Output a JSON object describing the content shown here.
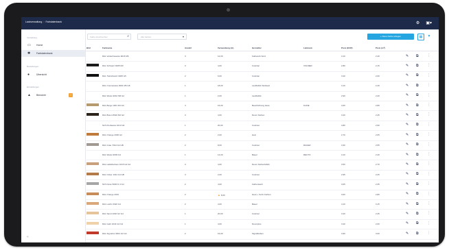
{
  "app": {
    "brand": "Lackverwaltung",
    "section": "Farbdatenbank",
    "colors": {
      "topbar": "#1e2a4a",
      "accent": "#26a6e0",
      "warning": "#f2a43a"
    }
  },
  "topbar": {
    "settings_icon": "gear-icon",
    "user_icon": "user-menu-icon",
    "settings_glyph": "⚙",
    "user_glyph": "▣▾"
  },
  "sidebar": {
    "section_1": "Verwaltung",
    "section_2": "Bestellungen",
    "section_3": "Einstellungen",
    "items": [
      {
        "label": "Home",
        "icon": "home-icon",
        "glyph": "▭",
        "active": false
      },
      {
        "label": "Farbdatenbank",
        "icon": "palette-icon",
        "glyph": "✱",
        "active": true
      },
      {
        "label": "Übersicht",
        "icon": "dot-icon",
        "glyph": "●",
        "active": false
      },
      {
        "label": "Benutzer",
        "icon": "users-icon",
        "glyph": "▲",
        "active": false,
        "badge": "!"
      }
    ],
    "footer_glyph": "«"
  },
  "toolbar": {
    "search_placeholder": "Farbe durchsuchen",
    "search_glyph": "⌕",
    "filter_value": "Alle Farben",
    "filter_glyph": "▾",
    "new_button_label": "+ Neue Farbe anlegen",
    "grid_glyph": "▦",
    "filter_icon_glyph": "▼"
  },
  "table": {
    "columns": [
      "Bild",
      "Farbname",
      "Anzahl",
      "Verwendung (m)",
      "Hersteller",
      "Lieferant",
      "Preis (EUR)",
      "Preis (m²)"
    ],
    "edit_glyph": "✎",
    "copy_glyph": "⧉",
    "more_glyph": "⋮",
    "warn_glyph": "▲",
    "rows": [
      {
        "swatch": "#ffffff",
        "name": "RAL Verkehrsweiss 9016 M6",
        "count": "3",
        "usage": "12,00",
        "maker": "Farbwerk Nord",
        "supplier": "",
        "price": "3,10",
        "price2": "2,40"
      },
      {
        "swatch": "#1a1a1a",
        "name": "RAL Schwarz 9005 M3",
        "count": "3",
        "usage": "4,00",
        "maker": "Colorlac",
        "supplier": "VOLMER",
        "price": "2,80",
        "price2": "2,15"
      },
      {
        "swatch": "#111111",
        "name": "RAL Tiefschwarz 9005 G5",
        "count": "2",
        "usage": "6,00",
        "maker": "Colorlac",
        "supplier": "",
        "price": "3,40",
        "price2": "2,60"
      },
      {
        "swatch": "#ffffff",
        "name": "RAL Cremeweiss 9001 M6 G8",
        "count": "1",
        "usage": "18,00",
        "maker": "Lackfabrik Südwest",
        "supplier": "",
        "price": "3,10",
        "price2": "2,40"
      },
      {
        "swatch": "#ffffff",
        "name": "RAL Weiss 9010 M6 G2",
        "count": "1",
        "usage": "2,00",
        "maker": "Lackfabrik",
        "supplier": "",
        "price": "2,90",
        "price2": "2,20"
      },
      {
        "swatch": "#b59a6e",
        "name": "RAL Beige 1001 M4 G3",
        "count": "4",
        "usage": "16,00",
        "maker": "Beschichtung Hess",
        "supplier": "KLINE",
        "price": "3,60",
        "price2": "2,80"
      },
      {
        "swatch": "#2c241b",
        "name": "RAL Braun 8022 M2 G2",
        "count": "3",
        "usage": "4,00",
        "maker": "Decor Farben",
        "supplier": "",
        "price": "3,20",
        "price2": "2,45"
      },
      {
        "swatch": "#ffffff",
        "name": "NCS Perlweiss 1013 G6",
        "count": "1",
        "usage": "20,00",
        "maker": "Colortec",
        "supplier": "",
        "price": "3,80",
        "price2": "2,90"
      },
      {
        "swatch": "#c07a3b",
        "name": "RAL Orange 2000 G2",
        "count": "2",
        "usage": "2,00",
        "maker": "Hein",
        "supplier": "",
        "price": "2,70",
        "price2": "2,05"
      },
      {
        "swatch": "#a09a92",
        "name": "RAL Grau 7044 G4 GB",
        "count": "2",
        "usage": "8,00",
        "maker": "Colortec",
        "supplier": "RAUER",
        "price": "3,30",
        "price2": "2,55"
      },
      {
        "swatch": "#ffffff",
        "name": "RAL Weiss 9003 G4",
        "count": "1",
        "usage": "14,00",
        "maker": "Bauer",
        "supplier": "REUTO",
        "price": "3,10",
        "price2": "2,40"
      },
      {
        "swatch": "#c9a07c",
        "name": "RAL Hellelfenbein 1015 G2 G4",
        "count": "3",
        "usage": "4,00",
        "maker": "Decor Farbenfabrik",
        "supplier": "",
        "price": "3,50",
        "price2": "2,70"
      },
      {
        "swatch": "#b47a4a",
        "name": "RAL Ocker 1011 G4 GB",
        "count": "3",
        "usage": "2,00",
        "maker": "Colortec",
        "supplier": "",
        "price": "2,95",
        "price2": "2,25"
      },
      {
        "swatch": "#a6a6a6",
        "name": "NCS Grau 5000 N 4 G4",
        "count": "2",
        "usage": "4,00",
        "maker": "Farbenwerk",
        "supplier": "",
        "price": "3,05",
        "price2": "2,35"
      },
      {
        "swatch": "#c78c5a",
        "name": "RAL Orange 2001",
        "count": "2",
        "usage": "8,00",
        "maker": "Hess + Sohn Farben",
        "supplier": "",
        "price": "3,60",
        "price2": "2,80",
        "warn": true
      },
      {
        "swatch": "#d9a77a",
        "name": "RAL Lachs 3022 G4",
        "count": "2",
        "usage": "4,00",
        "maker": "Bauer",
        "supplier": "",
        "price": "4,10",
        "price2": "3,15"
      },
      {
        "swatch": "#e6c49a",
        "name": "RAL Sand 1002 G2 G4",
        "count": "1",
        "usage": "20,00",
        "maker": "Colortec",
        "supplier": "",
        "price": "3,20",
        "price2": "2,45"
      },
      {
        "swatch": "#f0d2a8",
        "name": "RAL Gelb 1034 G2 G4",
        "count": "1",
        "usage": "4,00",
        "maker": "Decorplus",
        "supplier": "",
        "price": "3,40",
        "price2": "2,60"
      },
      {
        "swatch": "#c0392b",
        "name": "RAL Signalrot 3001 G2 G4",
        "count": "2",
        "usage": "16,00",
        "maker": "Signalfarben",
        "supplier": "",
        "price": "3,90",
        "price2": "3,00"
      }
    ]
  }
}
